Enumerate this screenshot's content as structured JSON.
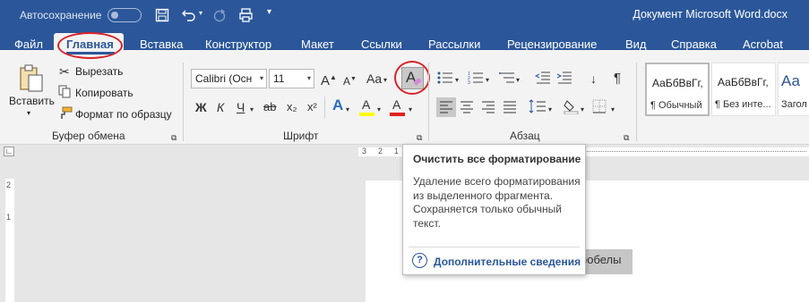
{
  "window": {
    "title": "Документ Microsoft Word.docx",
    "autosave_label": "Автосохранение"
  },
  "quick_access": {
    "icons": [
      "save-icon",
      "undo-icon",
      "redo-icon",
      "print-preview-icon",
      "customize-icon"
    ]
  },
  "tabs": [
    "Файл",
    "Главная",
    "Вставка",
    "Конструктор",
    "Макет",
    "Ссылки",
    "Рассылки",
    "Рецензирование",
    "Вид",
    "Справка",
    "Acrobat"
  ],
  "active_tab": "Главная",
  "clipboard": {
    "paste": "Вставить",
    "cut": "Вырезать",
    "copy": "Копировать",
    "format_painter": "Формат по образцу",
    "group": "Буфер обмена"
  },
  "font": {
    "name": "Calibri (Осн",
    "size": "11",
    "change_case": "Aa",
    "bold": "Ж",
    "italic": "К",
    "underline": "Ч",
    "strike": "ab",
    "subscript": "x₂",
    "superscript": "x²",
    "text_effects": "A",
    "highlight": "A",
    "font_color": "A",
    "clear_format": "A",
    "group": "Шрифт"
  },
  "paragraph": {
    "group": "Абзац",
    "pilcrow": "¶"
  },
  "styles": [
    {
      "sample": "АаБбВвГг,",
      "name": "¶ Обычный"
    },
    {
      "sample": "АаБбВвГг,",
      "name": "¶ Без инте..."
    },
    {
      "sample": "Аа",
      "name": "Загол"
    }
  ],
  "tooltip": {
    "title": "Очистить все форматирование",
    "body": "Удаление всего форматирования из выделенного фрагмента. Сохраняется только обычный текст.",
    "link": "Дополнительные сведения"
  },
  "document": {
    "visible_text": "робелы"
  },
  "ruler": {
    "top_marks": [
      "3",
      "2",
      "1"
    ],
    "left_marks": [
      "2",
      "1"
    ]
  },
  "colors": {
    "accent": "#2b579a",
    "highlight_yellow": "#ffff00",
    "font_red": "#e02020",
    "annotation_red": "#d8232a"
  }
}
